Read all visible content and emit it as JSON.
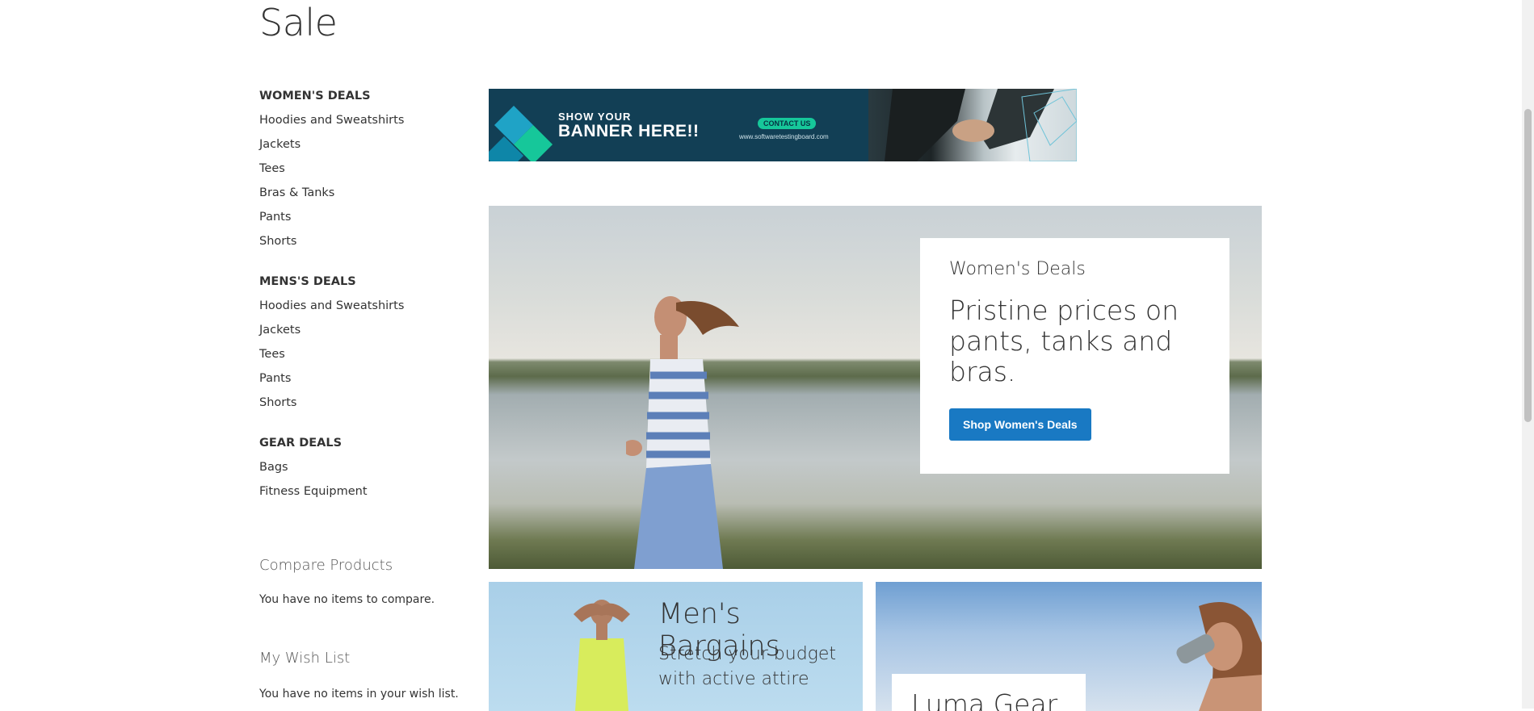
{
  "page": {
    "title": "Sale"
  },
  "sidebar": {
    "groups": [
      {
        "title": "WOMEN'S DEALS",
        "items": [
          "Hoodies and Sweatshirts",
          "Jackets",
          "Tees",
          "Bras & Tanks",
          "Pants",
          "Shorts"
        ]
      },
      {
        "title": "MENS'S DEALS",
        "items": [
          "Hoodies and Sweatshirts",
          "Jackets",
          "Tees",
          "Pants",
          "Shorts"
        ]
      },
      {
        "title": "GEAR DEALS",
        "items": [
          "Bags",
          "Fitness Equipment"
        ]
      }
    ]
  },
  "compare": {
    "title": "Compare Products",
    "empty_text": "You have no items to compare."
  },
  "wishlist": {
    "title": "My Wish List",
    "empty_text": "You have no items in your wish list."
  },
  "banner_ad": {
    "line1": "SHOW YOUR",
    "line2": "BANNER HERE!!",
    "contact": "CONTACT US",
    "url": "www.softwaretestingboard.com"
  },
  "hero": {
    "kicker": "Women's Deals",
    "headline": "Pristine prices on pants, tanks and bras.",
    "button_label": "Shop Women's Deals"
  },
  "promos": {
    "men": {
      "title": "Men's Bargains",
      "subtitle": "Stretch your budget with active attire"
    },
    "gear": {
      "title": "Luma Gear"
    }
  },
  "colors": {
    "accent": "#1979c3",
    "ad_background": "#123f55",
    "ad_button": "#16c79a"
  }
}
